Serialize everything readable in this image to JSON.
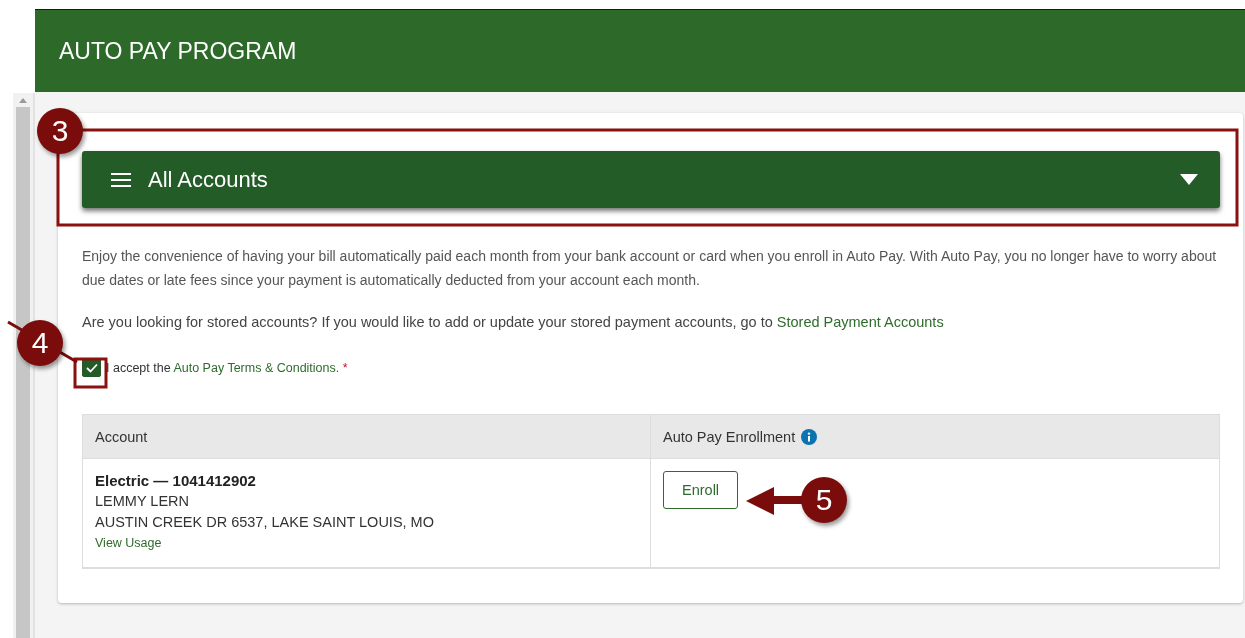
{
  "header": {
    "title": "AUTO PAY PROGRAM"
  },
  "account_selector": {
    "label": "All Accounts"
  },
  "intro": "Enjoy the convenience of having your bill automatically paid each month from your bank account or card when you enroll in Auto Pay. With Auto Pay, you no longer have to worry about due dates or late fees since your payment is automatically deducted from your account each month.",
  "stored_accounts": {
    "text": "Are you looking for stored accounts? If you would like to add or update your stored payment accounts, go to",
    "link": "Stored Payment Accounts"
  },
  "terms": {
    "checked": true,
    "prefix": "I accept the",
    "link": "Auto Pay Terms & Conditions.",
    "required_mark": "*"
  },
  "table": {
    "columns": [
      {
        "label": "Account",
        "info": false
      },
      {
        "label": "Auto Pay Enrollment",
        "info": true
      }
    ],
    "rows": [
      {
        "title": "Electric — 1041412902",
        "name": "LEMMY LERN",
        "address": "AUSTIN CREEK DR 6537, LAKE SAINT LOUIS, MO",
        "link": "View Usage",
        "action": "Enroll"
      }
    ]
  },
  "annotations": [
    {
      "number": "3"
    },
    {
      "number": "4"
    },
    {
      "number": "5"
    }
  ]
}
